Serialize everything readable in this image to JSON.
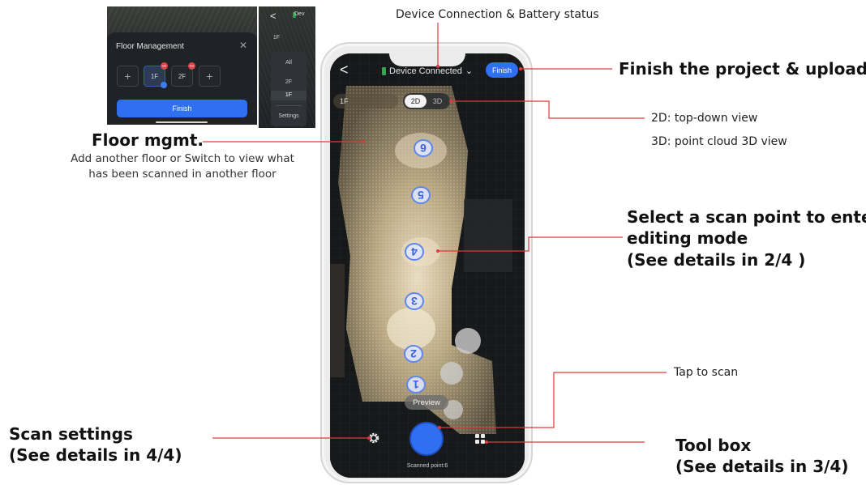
{
  "annotations": {
    "device_status": "Device Connection & Battery status",
    "finish_upload": "Finish the project & upload",
    "view_2d": "2D: top-down view",
    "view_3d": "3D: point cloud 3D view",
    "scan_point_line1": "Select a scan point to enter",
    "scan_point_line2": "editing mode",
    "scan_point_line3": "(See details in 2/4 )",
    "floor_mgmt_title": "Floor mgmt.",
    "floor_mgmt_desc1": "Add another floor or Switch to view what",
    "floor_mgmt_desc2": "has been scanned in another floor",
    "tap_to_scan": "Tap to scan",
    "scan_settings_line1": "Scan settings",
    "scan_settings_line2": "(See details in 4/4)",
    "tool_box_line1": "Tool box",
    "tool_box_line2": "(See details in 3/4)"
  },
  "floor_management_dialog": {
    "title": "Floor Management",
    "close_icon": "close-icon",
    "add_icon": "+",
    "floors": [
      "1F",
      "2F"
    ],
    "active_floor": "1F",
    "finish_label": "Finish"
  },
  "floor_list": {
    "back_icon": "<",
    "device_label": "Dev",
    "items": [
      "1F",
      "All",
      "2F",
      "1F"
    ],
    "active_item": "1F",
    "settings_label": "Settings"
  },
  "screen": {
    "back_icon": "<",
    "device_status": "Device Connected",
    "finish_label": "Finish",
    "floor_selector": "1F",
    "view_modes": [
      "2D",
      "3D"
    ],
    "active_view": "2D",
    "scan_points": [
      "6",
      "5",
      "4",
      "3",
      "2",
      "1"
    ],
    "preview_label": "Preview",
    "scanned_points_text": "Scanned point:6",
    "gear_icon": "gear-icon",
    "toolbox_icon": "grid-icon"
  },
  "colors": {
    "accent_blue": "#2f6ff2",
    "leader_red": "#e03a3a",
    "battery_green": "#31a653"
  }
}
